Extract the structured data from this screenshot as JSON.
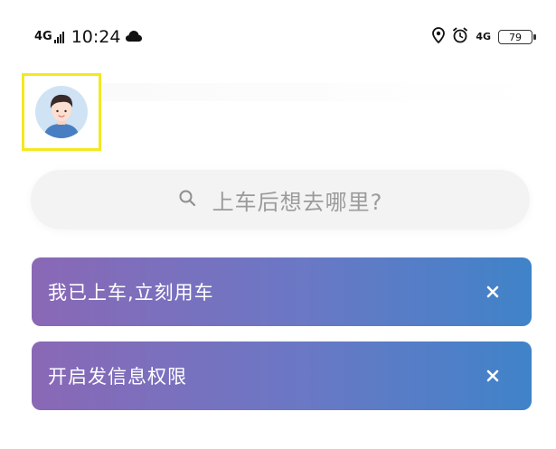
{
  "status_bar": {
    "network_left": "4G",
    "time": "10:24",
    "network_right": "4G",
    "battery_level": "79",
    "icons": [
      "signal-icon",
      "cloud-icon",
      "location-icon",
      "alarm-icon",
      "battery-icon"
    ]
  },
  "header": {
    "avatar_icon": "user-avatar"
  },
  "search": {
    "placeholder": "上车后想去哪里?",
    "icon": "search-icon"
  },
  "banners": [
    {
      "label": "我已上车,立刻用车",
      "close_icon": "close-icon"
    },
    {
      "label": "开启发信息权限",
      "close_icon": "close-icon"
    }
  ],
  "colors": {
    "banner_start": "#8a68b6",
    "banner_end": "#3f83c9",
    "highlight_border": "#f4e820",
    "search_bg": "#f3f3f3",
    "placeholder_text": "#9b9b9b"
  }
}
